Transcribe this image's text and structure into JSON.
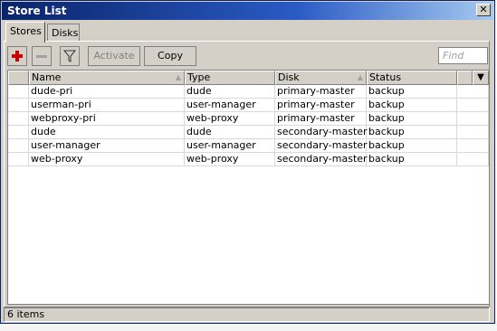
{
  "window": {
    "title": "Store List",
    "close_glyph": "✕"
  },
  "tabs": [
    {
      "label": "Stores",
      "active": true
    },
    {
      "label": "Disks",
      "active": false
    }
  ],
  "toolbar": {
    "add_icon": "plus-icon",
    "remove_icon": "minus-icon",
    "filter_icon": "filter-icon",
    "activate_label": "Activate",
    "copy_label": "Copy",
    "find_placeholder": "Find"
  },
  "table": {
    "columns": [
      "Name",
      "Type",
      "Disk",
      "Status"
    ],
    "rows": [
      {
        "name": "dude-pri",
        "type": "dude",
        "disk": "primary-master",
        "status": "backup"
      },
      {
        "name": "userman-pri",
        "type": "user-manager",
        "disk": "primary-master",
        "status": "backup"
      },
      {
        "name": "webproxy-pri",
        "type": "web-proxy",
        "disk": "primary-master",
        "status": "backup"
      },
      {
        "name": "dude",
        "type": "dude",
        "disk": "secondary-master",
        "status": "backup"
      },
      {
        "name": "user-manager",
        "type": "user-manager",
        "disk": "secondary-master",
        "status": "backup"
      },
      {
        "name": "web-proxy",
        "type": "web-proxy",
        "disk": "secondary-master",
        "status": "backup"
      }
    ]
  },
  "status": {
    "count_text": "6 items"
  },
  "colors": {
    "title_bar": "#0a246a",
    "window_bg": "#d4d0c8",
    "add_icon": "#cc0000"
  }
}
